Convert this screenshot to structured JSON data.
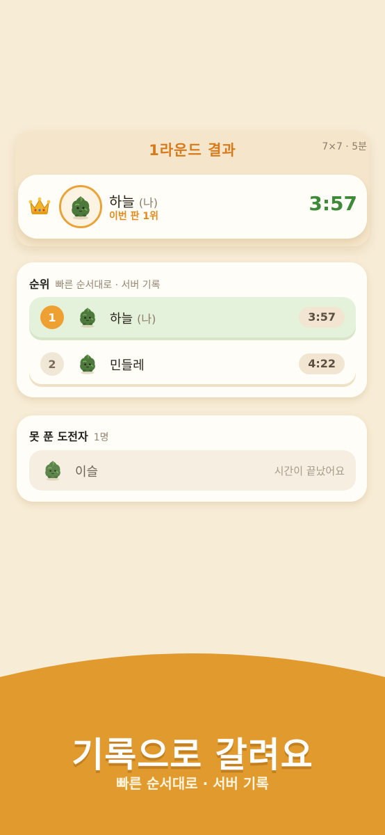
{
  "result": {
    "title": "1라운드 결과",
    "meta": "7×7 · 5분",
    "winner": {
      "name": "하늘",
      "me_tag": "(나)",
      "subtitle": "이번 판 1위",
      "time": "3:57"
    }
  },
  "ranking": {
    "heading": "순위",
    "subheading": "빠른 순서대로 · 서버 기록",
    "rows": [
      {
        "rank": "1",
        "name": "하늘",
        "me_tag": "(나)",
        "time": "3:57"
      },
      {
        "rank": "2",
        "name": "민들레",
        "me_tag": "",
        "time": "4:22"
      }
    ]
  },
  "unfinished": {
    "heading": "못 푼 도전자",
    "count": "1명",
    "rows": [
      {
        "name": "이슬",
        "status": "시간이 끝났어요"
      }
    ]
  },
  "banner": {
    "title": "기록으로 갈려요",
    "subtitle": "빠른 순서대로 · 서버 기록"
  },
  "colors": {
    "background": "#f7ecd6",
    "accent_orange": "#e9982e",
    "time_green": "#3e8a3a",
    "highlight_row": "#e4f2db"
  },
  "icons": {
    "crown": "crown-icon",
    "avatar": "sprout-creature-avatar"
  }
}
